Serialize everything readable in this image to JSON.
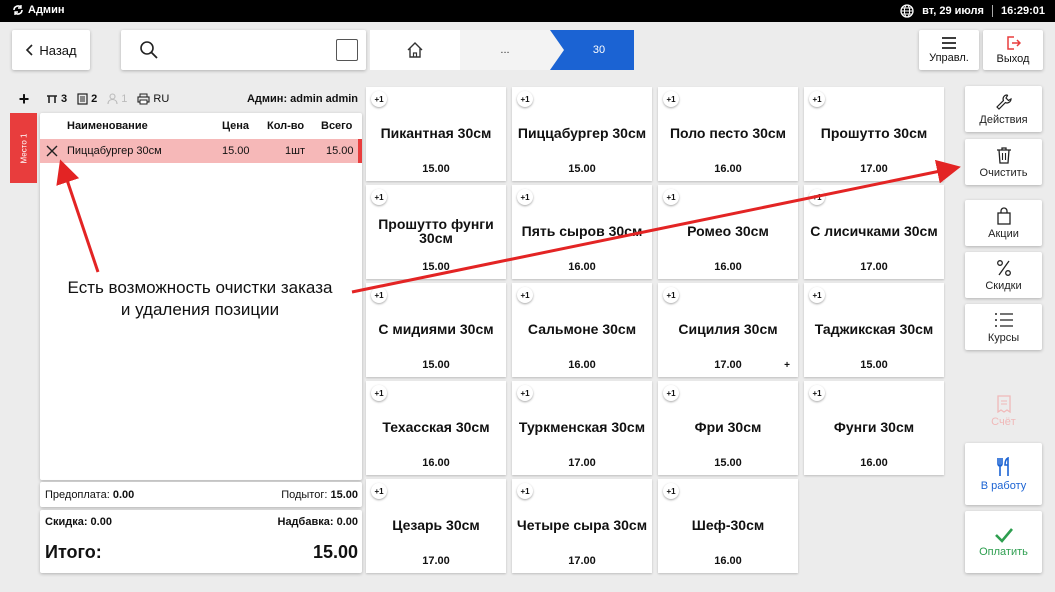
{
  "statusbar": {
    "app_name": "Админ",
    "date": "вт, 29 июля",
    "time": "16:29:01"
  },
  "nav": {
    "back_label": "Назад",
    "search_placeholder": "",
    "breadcrumbs": [
      "...",
      "30"
    ],
    "manage_label": "Управл.",
    "exit_label": "Выход"
  },
  "order": {
    "header": {
      "tables": "3",
      "docs": "2",
      "guests": "1",
      "lang": "RU",
      "admin": "Админ: admin admin"
    },
    "seat_label": "Место 1",
    "columns": {
      "name": "Наименование",
      "price": "Цена",
      "qty": "Кол-во",
      "total": "Всего"
    },
    "items": [
      {
        "name": "Пиццабургер 30см",
        "price": "15.00",
        "qty": "1шт",
        "total": "15.00"
      }
    ],
    "prepay_label": "Предоплата:",
    "prepay_value": "0.00",
    "subtotal_label": "Подытог:",
    "subtotal_value": "15.00",
    "discount_label": "Скидка:",
    "discount_value": "0.00",
    "markup_label": "Надбавка:",
    "markup_value": "0.00",
    "total_label": "Итого:",
    "total_value": "15.00"
  },
  "products": [
    {
      "name": "Пикантная 30см",
      "price": "15.00",
      "badge": "+1"
    },
    {
      "name": "Пиццабургер 30см",
      "price": "15.00",
      "badge": "+1"
    },
    {
      "name": "Поло песто 30см",
      "price": "16.00",
      "badge": "+1"
    },
    {
      "name": "Прошутто 30см",
      "price": "17.00",
      "badge": "+1"
    },
    {
      "name": "Прошутто фунги 30см",
      "price": "15.00",
      "badge": "+1"
    },
    {
      "name": "Пять сыров 30см",
      "price": "16.00",
      "badge": "+1"
    },
    {
      "name": "Ромео 30см",
      "price": "16.00",
      "badge": "+1"
    },
    {
      "name": "С лисичками 30см",
      "price": "17.00",
      "badge": "+1"
    },
    {
      "name": "С мидиями 30см",
      "price": "15.00",
      "badge": "+1"
    },
    {
      "name": "Сальмоне 30см",
      "price": "16.00",
      "badge": "+1"
    },
    {
      "name": "Сицилия 30см",
      "price": "17.00",
      "badge": "+1",
      "plus": "+"
    },
    {
      "name": "Таджикская 30см",
      "price": "15.00",
      "badge": "+1"
    },
    {
      "name": "Техасская 30см",
      "price": "16.00",
      "badge": "+1"
    },
    {
      "name": "Туркменская 30см",
      "price": "17.00",
      "badge": "+1"
    },
    {
      "name": "Фри 30см",
      "price": "15.00",
      "badge": "+1"
    },
    {
      "name": "Фунги 30см",
      "price": "16.00",
      "badge": "+1"
    },
    {
      "name": "Цезарь 30см",
      "price": "17.00",
      "badge": "+1"
    },
    {
      "name": "Четыре сыра 30см",
      "price": "17.00",
      "badge": "+1"
    },
    {
      "name": "Шеф-30см",
      "price": "16.00",
      "badge": "+1"
    }
  ],
  "actions": {
    "actions_label": "Действия",
    "clear_label": "Очистить",
    "promo_label": "Акции",
    "discounts_label": "Скидки",
    "courses_label": "Курсы",
    "bill_label": "Счёт",
    "work_label": "В работу",
    "pay_label": "Оплатить"
  },
  "annotation": {
    "line1": "Есть возможность очистки заказа",
    "line2": "и удаления позиции"
  },
  "colors": {
    "accent": "#1b63d3",
    "danger": "#e83d3d",
    "success": "#2d9e4f",
    "row_highlight": "#f6b8b8"
  }
}
